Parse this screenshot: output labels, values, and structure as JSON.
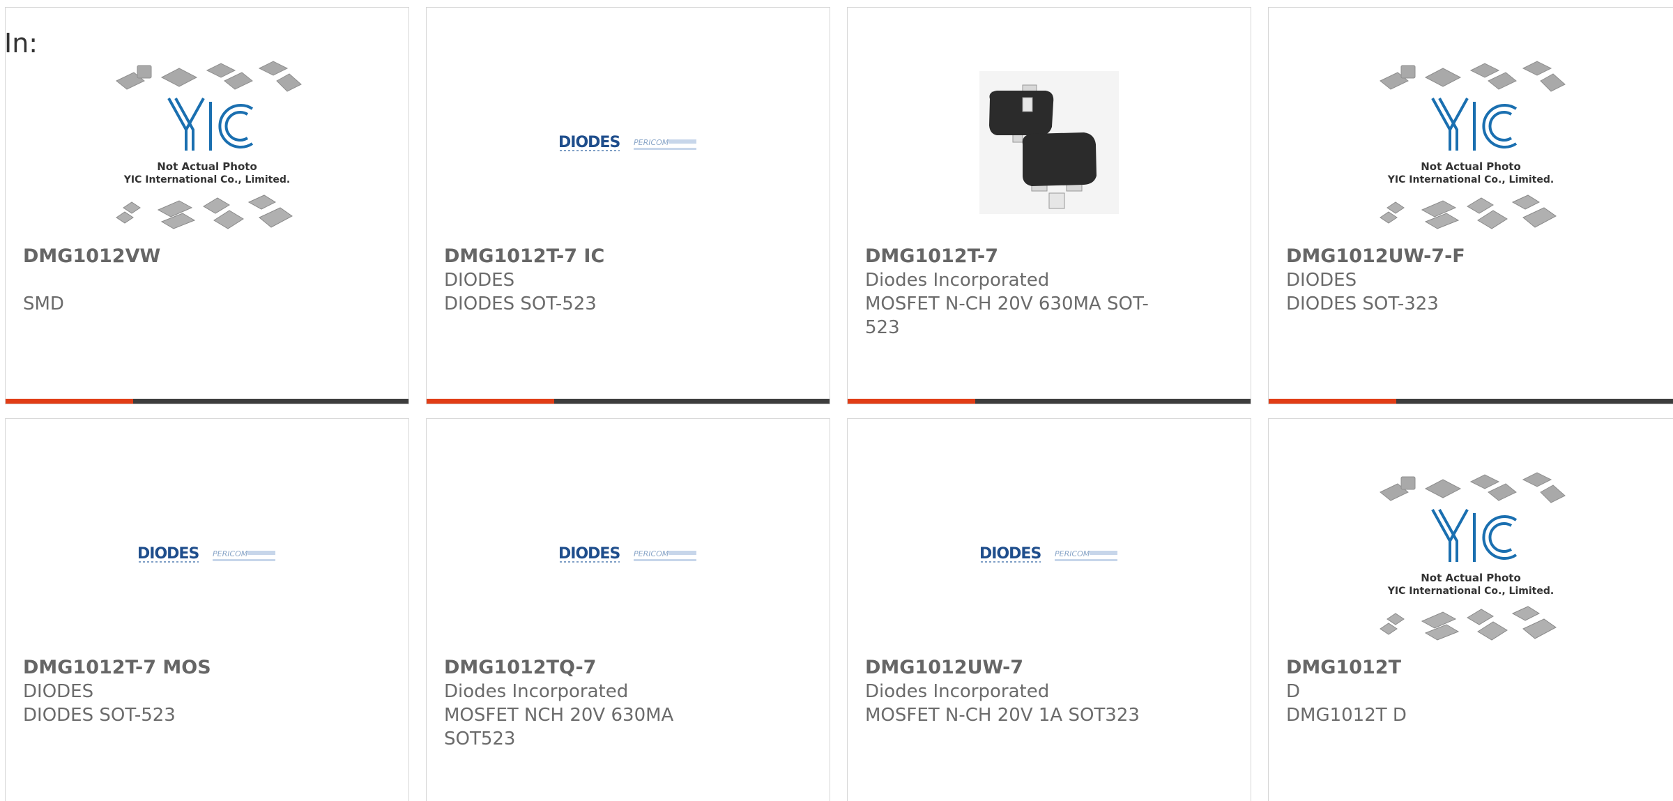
{
  "label": {
    "in": "In:"
  },
  "colors": {
    "accent_bar": "#e13d16",
    "base_bar": "#3d3d3d",
    "diodes_blue": "#1f4e8c",
    "yic_blue": "#1a6fb0"
  },
  "cards": [
    {
      "part": "DMG1012VW",
      "manufacturer": "",
      "description": "SMD",
      "image": "yic-not-actual-photo",
      "logo_text": [
        "Not Actual Photo",
        "YIC International Co., Limited."
      ]
    },
    {
      "part": "DMG1012T-7 IC",
      "manufacturer": "DIODES",
      "description": "DIODES SOT-523",
      "image": "diodes-pericom-logo"
    },
    {
      "part": "DMG1012T-7",
      "manufacturer": "Diodes Incorporated",
      "description": "MOSFET N-CH 20V 630MA SOT-523",
      "image": "sot523-package-photo"
    },
    {
      "part": "DMG1012UW-7-F",
      "manufacturer": "DIODES",
      "description": "DIODES SOT-323",
      "image": "yic-not-actual-photo",
      "logo_text": [
        "Not Actual Photo",
        "YIC International Co., Limited."
      ]
    },
    {
      "part": "DMG1012T-7 MOS",
      "manufacturer": "DIODES",
      "description": "DIODES SOT-523",
      "image": "diodes-pericom-logo"
    },
    {
      "part": "DMG1012TQ-7",
      "manufacturer": "Diodes Incorporated",
      "description": "MOSFET NCH 20V 630MA SOT523",
      "image": "diodes-pericom-logo"
    },
    {
      "part": "DMG1012UW-7",
      "manufacturer": "Diodes Incorporated",
      "description": "MOSFET N-CH 20V 1A SOT323",
      "image": "diodes-pericom-logo"
    },
    {
      "part": "DMG1012T",
      "manufacturer": "D",
      "description": "DMG1012T D",
      "image": "yic-not-actual-photo",
      "logo_text": [
        "Not Actual Photo",
        "YIC International Co., Limited."
      ]
    }
  ]
}
